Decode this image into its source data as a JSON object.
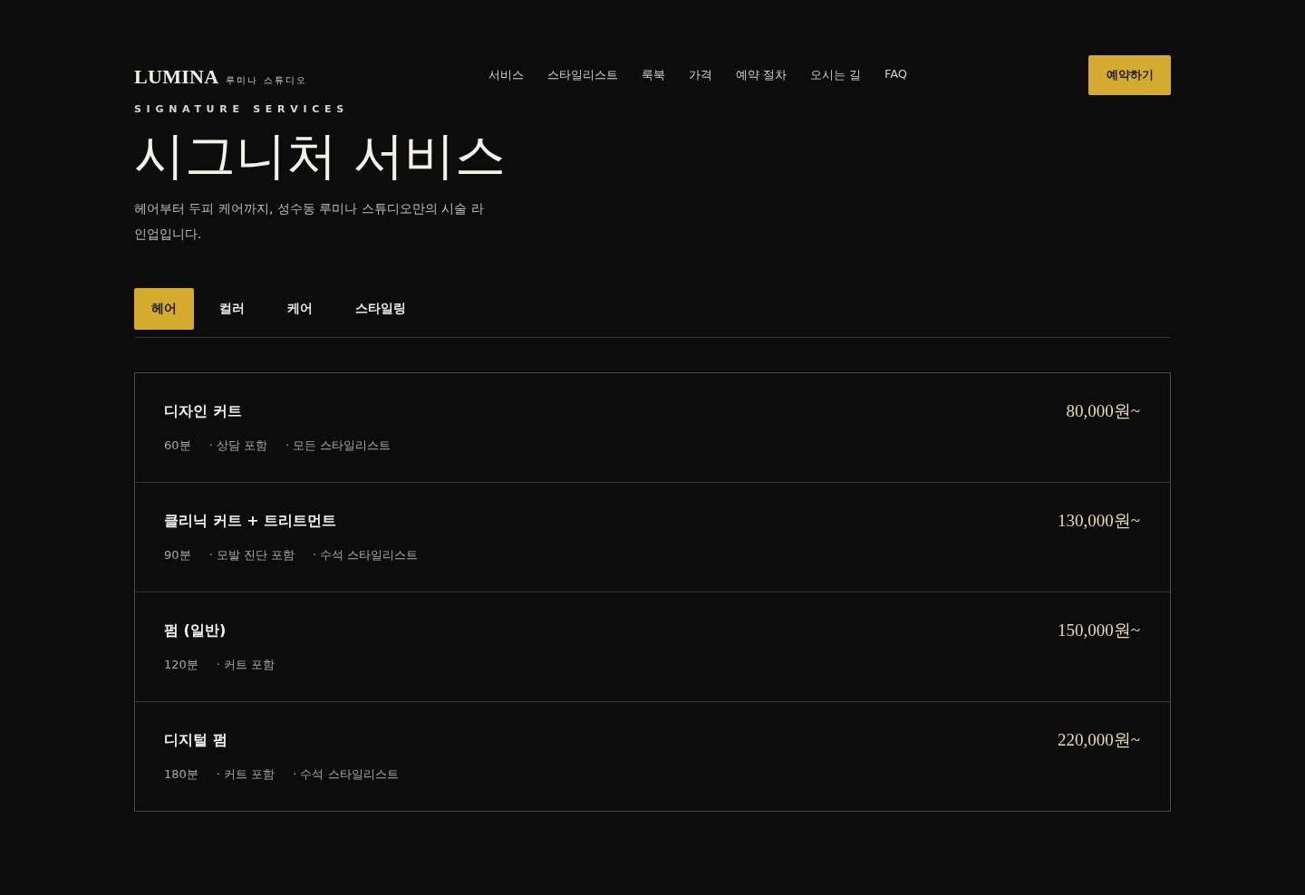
{
  "header": {
    "logo": "LUMINA",
    "logo_subtitle": "루미나 스튜디오",
    "nav": [
      "서비스",
      "스타일리스트",
      "룩북",
      "가격",
      "예약 절차",
      "오시는 길",
      "FAQ"
    ],
    "cta": "예약하기"
  },
  "hero": {
    "eyebrow": "SIGNATURE SERVICES",
    "title": "시그니처 서비스",
    "description": "헤어부터 두피 케어까지, 성수동 루미나 스튜디오만의 시술 라인업입니다."
  },
  "tabs": [
    {
      "label": "헤어",
      "selected": true
    },
    {
      "label": "컬러",
      "selected": false
    },
    {
      "label": "케어",
      "selected": false
    },
    {
      "label": "스타일링",
      "selected": false
    }
  ],
  "services": [
    {
      "name": "디자인 커트",
      "duration": "60분",
      "details": [
        "· 상담 포함",
        "· 모든 스타일리스트"
      ],
      "price": "80,000원~"
    },
    {
      "name": "클리닉 커트 + 트리트먼트",
      "duration": "90분",
      "details": [
        "· 모발 진단 포함",
        "· 수석 스타일리스트"
      ],
      "price": "130,000원~"
    },
    {
      "name": "펌 (일반)",
      "duration": "120분",
      "details": [
        "· 커트 포함"
      ],
      "price": "150,000원~"
    },
    {
      "name": "디지털 펌",
      "duration": "180분",
      "details": [
        "· 커트 포함",
        "· 수석 스타일리스트"
      ],
      "price": "220,000원~"
    }
  ]
}
